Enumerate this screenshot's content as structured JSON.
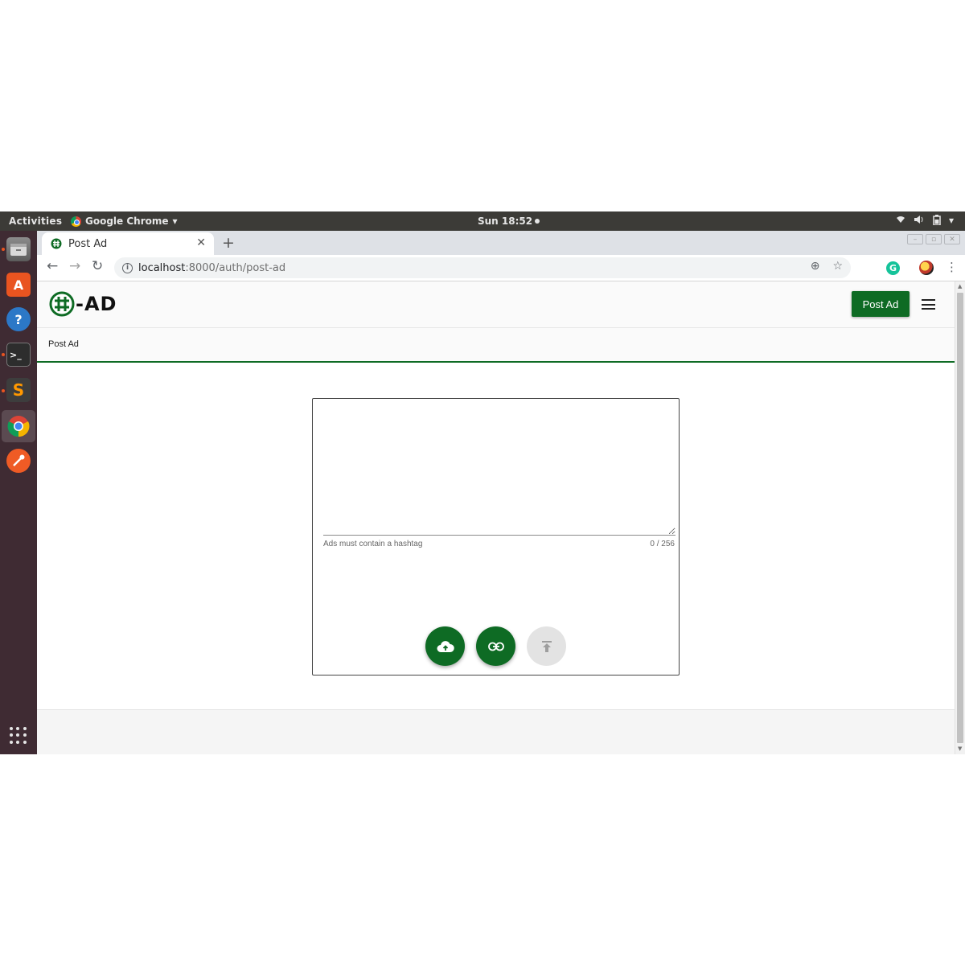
{
  "system_bar": {
    "activities": "Activities",
    "app_name": "Google Chrome",
    "clock": "Sun 18:52"
  },
  "dock": {
    "items": [
      "files-icon",
      "software-center-icon",
      "help-icon",
      "terminal-icon",
      "sublime-text-icon",
      "chrome-icon",
      "postman-icon"
    ],
    "show_apps": "apps-grid-icon"
  },
  "browser": {
    "tab_title": "Post Ad",
    "url_host": "localhost",
    "url_rest": ":8000/auth/post-ad",
    "grammarly_label": "G"
  },
  "app": {
    "logo_text": "-AD",
    "header_button": "Post Ad",
    "breadcrumb": "Post Ad",
    "textarea_value": "",
    "hint": "Ads must contain a hashtag",
    "counter": "0 / 256",
    "actions": {
      "upload": "cloud-upload-icon",
      "link": "link-icon",
      "submit": "publish-icon"
    }
  },
  "colors": {
    "brand_green": "#0e6b24",
    "topbar": "#3c3b37",
    "dock": "#3f2b33"
  }
}
